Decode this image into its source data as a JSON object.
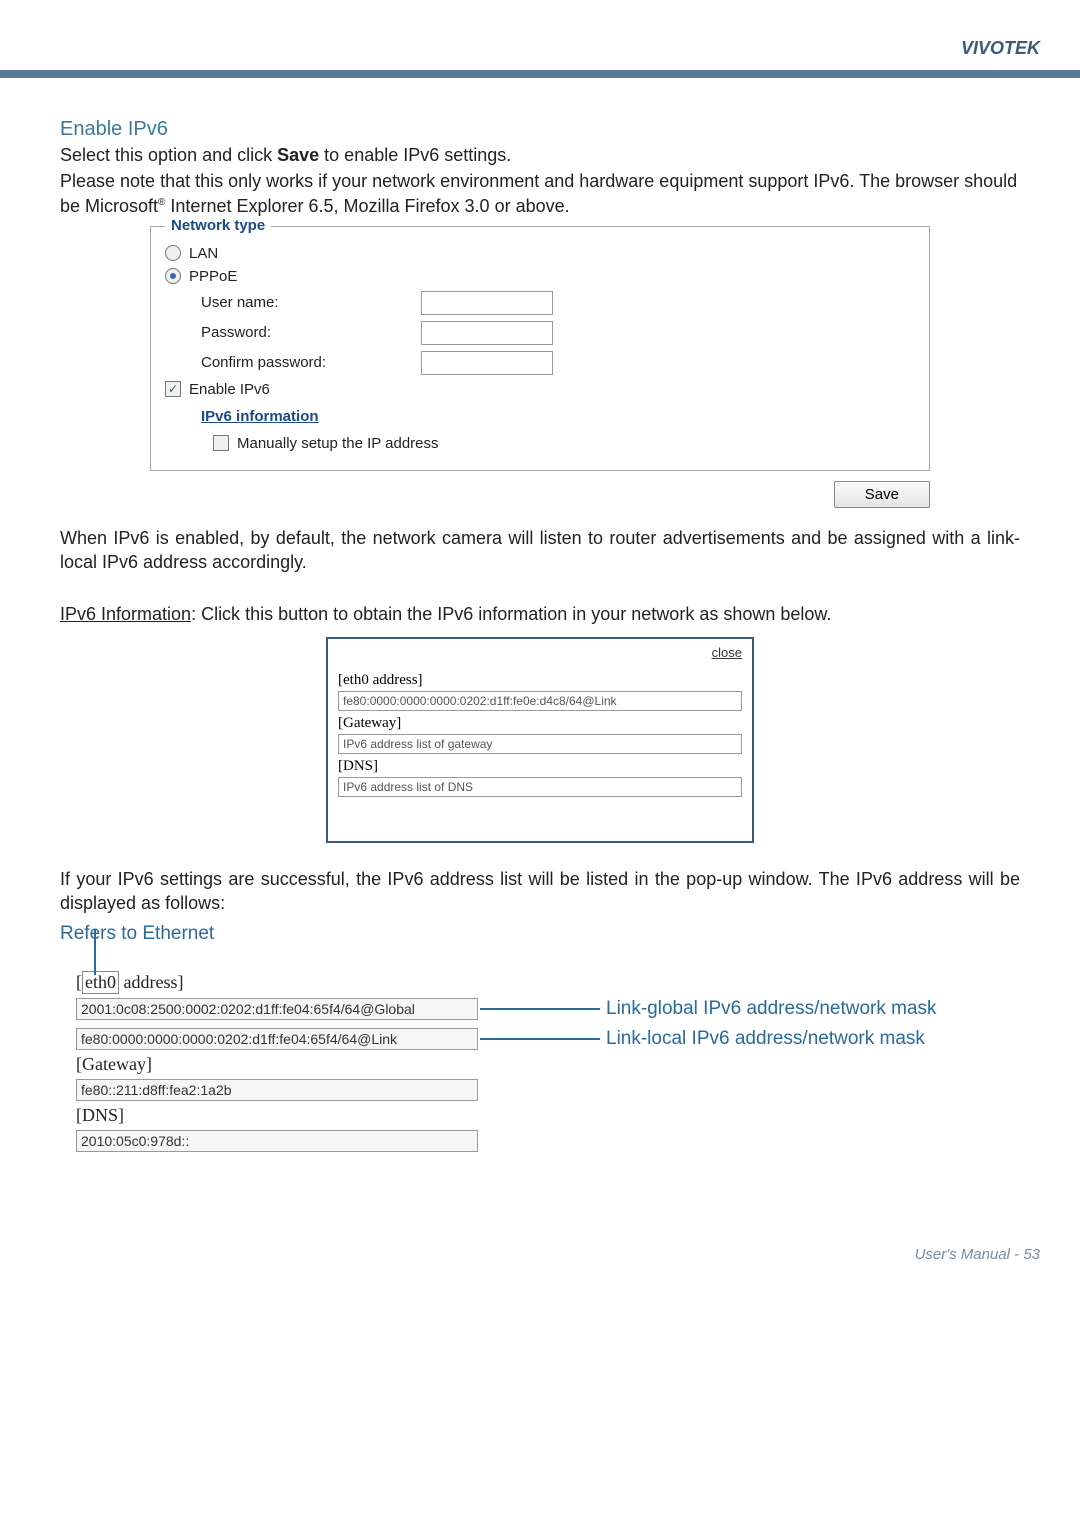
{
  "header": {
    "brand": "VIVOTEK"
  },
  "section": {
    "title": "Enable IPv6",
    "p1_a": "Select this option and click ",
    "p1_b": "Save",
    "p1_c": " to enable IPv6 settings.",
    "p2_a": "Please note that this only works if your network environment and hardware equipment support IPv6. The browser should be Microsoft",
    "p2_sup": "®",
    "p2_b": " Internet Explorer 6.5, Mozilla Firefox 3.0 or above."
  },
  "network_box": {
    "legend": "Network type",
    "lan": "LAN",
    "pppoe": "PPPoE",
    "username_label": "User name:",
    "password_label": "Password:",
    "confirm_label": "Confirm password:",
    "enable_ipv6": "Enable IPv6",
    "ipv6_info_link": "IPv6 information",
    "manual": "Manually setup the IP address",
    "save": "Save"
  },
  "p3": "When IPv6 is enabled, by default, the network camera will listen to router advertisements and be assigned with a link-local IPv6 address accordingly.",
  "p4_label": "IPv6 Information",
  "p4_rest": ": Click this button to obtain the IPv6 information in your network as shown below.",
  "popup": {
    "close": "close",
    "eth0": "[eth0 address]",
    "eth0_val": "fe80:0000:0000:0000:0202:d1ff:fe0e:d4c8/64@Link",
    "gateway": "[Gateway]",
    "gateway_val": "IPv6 address list of gateway",
    "dns": "[DNS]",
    "dns_val": "IPv6 address list of DNS"
  },
  "p5": "If your IPv6 settings are successful, the IPv6 address list will be listed in the pop-up window. The IPv6 address will be displayed as follows:",
  "refers": {
    "title": "Refers to Ethernet",
    "eth0_box": "eth0",
    "eth0_after": " address]",
    "global_addr": "2001:0c08:2500:0002:0202:d1ff:fe04:65f4/64@Global",
    "global_anno": "Link-global IPv6 address/network mask",
    "link_addr": "fe80:0000:0000:0000:0202:d1ff:fe04:65f4/64@Link",
    "link_anno": "Link-local IPv6 address/network mask",
    "gateway": "[Gateway]",
    "gateway_val": "fe80::211:d8ff:fea2:1a2b",
    "dns": "[DNS]",
    "dns_val": "2010:05c0:978d::"
  },
  "footer": {
    "label": "User's Manual - ",
    "page": "53"
  }
}
